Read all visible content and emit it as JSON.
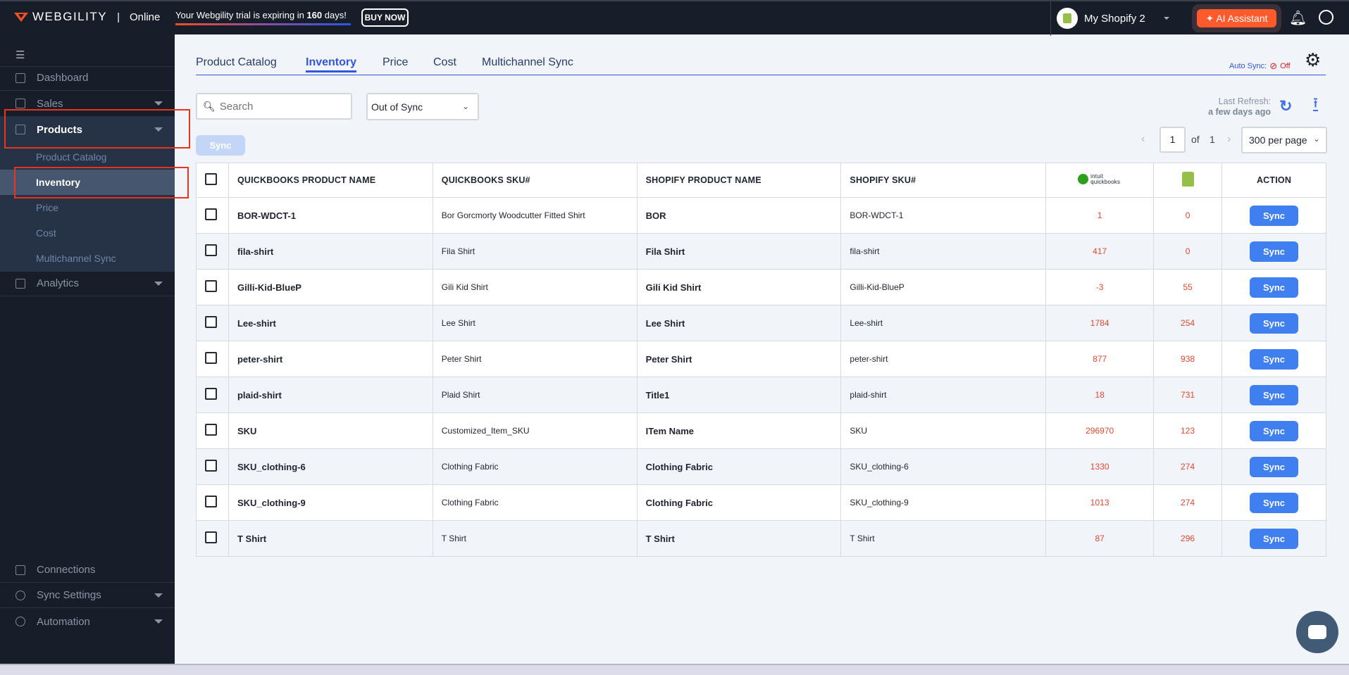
{
  "header": {
    "brand": "WEBGILITY",
    "edition": "Online",
    "trial_prefix": "Your Webgility trial is expiring in ",
    "trial_days": "160",
    "trial_suffix": " days!",
    "buy_now": "BUY NOW",
    "store": "My Shopify 2",
    "ai_assistant": "AI Assistant"
  },
  "sidebar": {
    "items": [
      {
        "label": "Dashboard"
      },
      {
        "label": "Sales"
      },
      {
        "label": "Products"
      },
      {
        "label": "Analytics"
      },
      {
        "label": "Connections"
      },
      {
        "label": "Sync Settings"
      },
      {
        "label": "Automation"
      }
    ],
    "sub": [
      "Product Catalog",
      "Inventory",
      "Price",
      "Cost",
      "Multichannel Sync"
    ]
  },
  "tabs": [
    "Product Catalog",
    "Inventory",
    "Price",
    "Cost",
    "Multichannel Sync"
  ],
  "auto_sync": {
    "label": "Auto Sync:",
    "value": "Off"
  },
  "toolbar": {
    "search_placeholder": "Search",
    "filter": "Out of Sync",
    "sync": "Sync",
    "last_refresh_label": "Last Refresh:",
    "last_refresh_value": "a few days ago"
  },
  "pagination": {
    "page": "1",
    "of": "of",
    "total": "1",
    "per_page": "300 per page"
  },
  "table": {
    "headers": [
      "QUICKBOOKS PRODUCT NAME",
      "QUICKBOOKS SKU#",
      "SHOPIFY PRODUCT NAME",
      "SHOPIFY SKU#",
      "quickbooks",
      "shopify",
      "ACTION"
    ],
    "qb_logo_text": "intuit quickbooks",
    "rows": [
      [
        "BOR-WDCT-1",
        "Bor Gorcmorty Woodcutter Fitted Shirt",
        "BOR",
        "BOR-WDCT-1",
        "1",
        "0"
      ],
      [
        "fila-shirt",
        "Fila Shirt",
        "Fila Shirt",
        "fila-shirt",
        "417",
        "0"
      ],
      [
        "Gilli-Kid-BlueP",
        "Gili Kid Shirt",
        "Gili Kid Shirt",
        "Gilli-Kid-BlueP",
        "-3",
        "55"
      ],
      [
        "Lee-shirt",
        "Lee Shirt",
        "Lee Shirt",
        "Lee-shirt",
        "1784",
        "254"
      ],
      [
        "peter-shirt",
        "Peter Shirt",
        "Peter Shirt",
        "peter-shirt",
        "877",
        "938"
      ],
      [
        "plaid-shirt",
        "Plaid Shirt",
        "Title1",
        "plaid-shirt",
        "18",
        "731"
      ],
      [
        "SKU",
        "Customized_Item_SKU",
        "ITem Name",
        "SKU",
        "296970",
        "123"
      ],
      [
        "SKU_clothing-6",
        "Clothing Fabric",
        "Clothing Fabric",
        "SKU_clothing-6",
        "1330",
        "274"
      ],
      [
        "SKU_clothing-9",
        "Clothing Fabric",
        "Clothing Fabric",
        "SKU_clothing-9",
        "1013",
        "274"
      ],
      [
        "T Shirt",
        "T Shirt",
        "T Shirt",
        "T Shirt",
        "87",
        "296"
      ]
    ],
    "action_label": "Sync"
  },
  "colors": {
    "accent": "#3f7ff0",
    "orange": "#ff5a2c",
    "sidebar": "#181e29",
    "red": "#e9462f"
  }
}
